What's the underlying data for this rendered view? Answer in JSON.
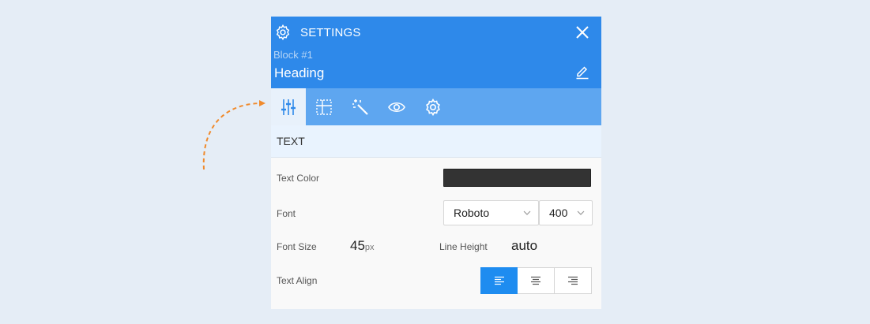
{
  "header": {
    "title": "SETTINGS",
    "block_label": "Block #1",
    "block_name": "Heading"
  },
  "toolbar": {
    "tools": [
      "sliders-icon",
      "grid-icon",
      "magic-wand-icon",
      "eye-icon",
      "gear-icon"
    ],
    "active": "sliders-icon"
  },
  "section": {
    "title": "TEXT"
  },
  "fields": {
    "text_color_label": "Text Color",
    "text_color_value": "#333333",
    "font_label": "Font",
    "font_family": "Roboto",
    "font_weight": "400",
    "font_size_label": "Font Size",
    "font_size_value": "45",
    "font_size_unit": "px",
    "line_height_label": "Line Height",
    "line_height_value": "auto",
    "text_align_label": "Text Align",
    "text_align_options": [
      "align-left-icon",
      "align-center-icon",
      "align-right-icon"
    ],
    "text_align_selected": "left"
  },
  "colors": {
    "header_bg": "#2e89ea",
    "toolbar_bg": "#5ea6f0",
    "accent": "#1e8cf0",
    "arrow": "#f08a2c"
  }
}
